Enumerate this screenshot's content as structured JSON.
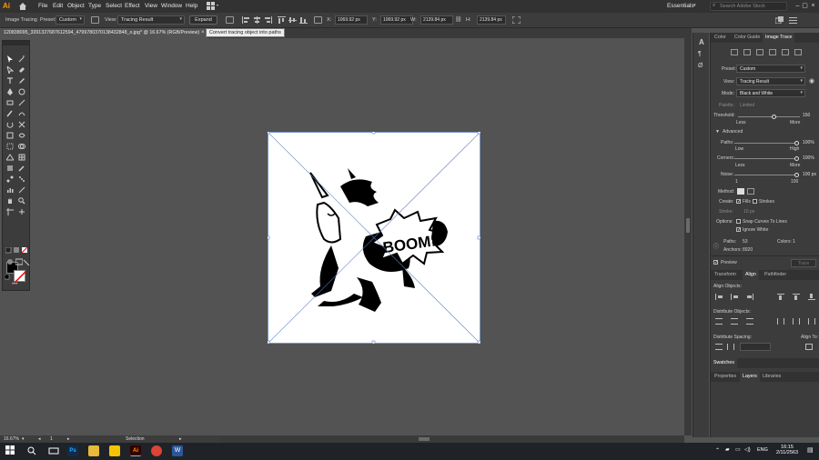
{
  "menubar": {
    "logo": "Ai",
    "items": [
      "File",
      "Edit",
      "Object",
      "Type",
      "Select",
      "Effect",
      "View",
      "Window",
      "Help"
    ],
    "workspace": "Essentials",
    "search_placeholder": "Search Adobe Stock"
  },
  "controlbar": {
    "mode_label": "Image Tracing",
    "preset_label": "Preset:",
    "preset_value": "Custom",
    "view_label": "View:",
    "view_value": "Tracing Result",
    "expand_label": "Expand",
    "x_label": "X:",
    "x_value": "1069.92 px",
    "y_label": "Y:",
    "y_value": "1069.92 px",
    "w_label": "W:",
    "w_value": "2139.84 px",
    "h_label": "H:",
    "h_value": "2139.84 px"
  },
  "tooltip": "Convert tracing object into paths",
  "document": {
    "tab_title": "120838095_3391327687612594_4799780370138432848_o.jpg* @ 16.67% (RGB/Preview)",
    "tab_close": "×"
  },
  "artwork": {
    "boom_text": "BOOM!"
  },
  "status": {
    "zoom": "16.67%",
    "artboard": "1",
    "tool": "Selection"
  },
  "panel_tabs": [
    "Color",
    "Color Guide",
    "Image Trace"
  ],
  "image_trace": {
    "preset_label": "Preset:",
    "preset_value": "Custom",
    "view_label": "View:",
    "view_value": "Tracing Result",
    "mode_label": "Mode:",
    "mode_value": "Black and White",
    "palette_label": "Palette:",
    "palette_value": "Limited",
    "threshold_label": "Threshold:",
    "threshold_value": "150",
    "threshold_less": "Less",
    "threshold_more": "More",
    "threshold_level": 0.58,
    "advanced_label": "Advanced",
    "paths_label": "Paths:",
    "paths_value": "100%",
    "paths_low": "Low",
    "paths_high": "High",
    "corners_label": "Corners:",
    "corners_value": "100%",
    "corners_less": "Less",
    "corners_more": "More",
    "noise_label": "Noise:",
    "noise_value": "100 px",
    "noise_min": "1",
    "noise_max": "100",
    "method_label": "Method:",
    "create_label": "Create:",
    "fills_label": "Fills",
    "strokes_label": "Strokes",
    "stroke_label": "Stroke:",
    "stroke_value": "10 px",
    "options_label": "Options:",
    "snap_label": "Snap Curves To Lines",
    "ignore_white_label": "Ignore White",
    "paths_count_label": "Paths:",
    "paths_count": "53",
    "colors_label": "Colors:",
    "colors_count": "1",
    "anchors_label": "Anchors:",
    "anchors_count": "8920",
    "preview_label": "Preview",
    "trace_label": "Trace"
  },
  "align_tabs": [
    "Transform",
    "Align",
    "Pathfinder"
  ],
  "align": {
    "align_objects": "Align Objects:",
    "distribute_objects": "Distribute Objects:",
    "distribute_spacing": "Distribute Spacing:",
    "align_to": "Align To:"
  },
  "swatches_tab": "Swatches",
  "bottom_tabs": [
    "Properties",
    "Layers",
    "Libraries"
  ],
  "taskbar": {
    "lang": "ENG",
    "time": "16:15",
    "date": "2/11/2563"
  }
}
